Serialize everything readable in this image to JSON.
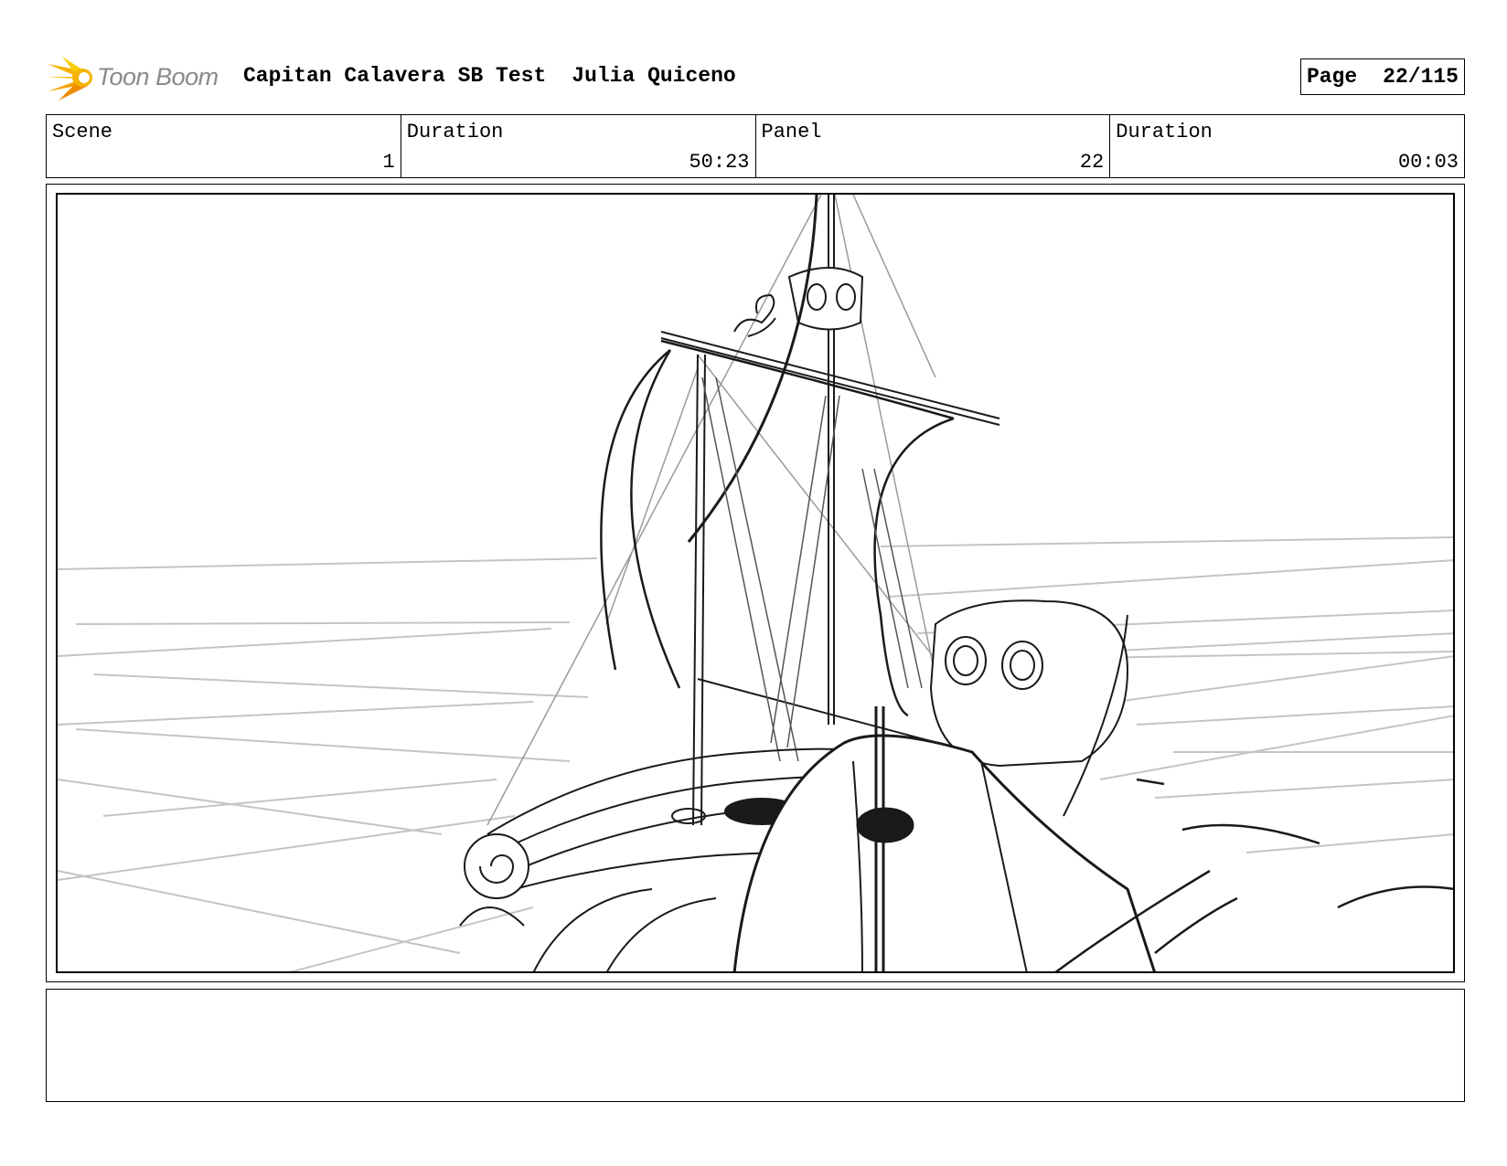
{
  "header": {
    "logo_text": "Toon Boom",
    "project_title": "Capitan Calavera SB Test",
    "author": "Julia Quiceno",
    "page_label": "Page",
    "page_number": "22/115"
  },
  "info": {
    "scene_label": "Scene",
    "scene_value": "1",
    "scene_duration_label": "Duration",
    "scene_duration_value": "50:23",
    "panel_label": "Panel",
    "panel_value": "22",
    "panel_duration_label": "Duration",
    "panel_duration_value": "00:03"
  },
  "notes": {
    "text": ""
  },
  "colors": {
    "logo_yellow": "#f5b400",
    "logo_orange": "#f08a00",
    "logo_gray": "#8a8a8a",
    "sketch_line": "#1a1a1a",
    "guide_line": "#c4c4c4"
  },
  "icons": {
    "logo": "starburst-logo-icon"
  }
}
